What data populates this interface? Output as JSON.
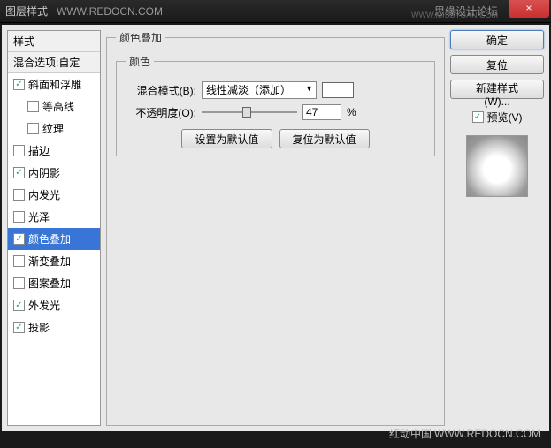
{
  "window": {
    "title": "图层样式",
    "watermark_left": "WWW.REDOCN.COM",
    "watermark_right_top": "思缘设计论坛",
    "watermark_right_sub": "WWW.MISSYUAN.COM",
    "close": "×"
  },
  "styles": {
    "header": "样式",
    "blend_options": "混合选项:自定",
    "items": [
      {
        "label": "斜面和浮雕",
        "checked": true,
        "indent": false
      },
      {
        "label": "等高线",
        "checked": false,
        "indent": true
      },
      {
        "label": "纹理",
        "checked": false,
        "indent": true
      },
      {
        "label": "描边",
        "checked": false,
        "indent": false
      },
      {
        "label": "内阴影",
        "checked": true,
        "indent": false
      },
      {
        "label": "内发光",
        "checked": false,
        "indent": false
      },
      {
        "label": "光泽",
        "checked": false,
        "indent": false
      },
      {
        "label": "颜色叠加",
        "checked": true,
        "indent": false,
        "selected": true
      },
      {
        "label": "渐变叠加",
        "checked": false,
        "indent": false
      },
      {
        "label": "图案叠加",
        "checked": false,
        "indent": false
      },
      {
        "label": "外发光",
        "checked": true,
        "indent": false
      },
      {
        "label": "投影",
        "checked": true,
        "indent": false
      }
    ]
  },
  "panel": {
    "outer_legend": "颜色叠加",
    "inner_legend": "颜色",
    "blend_mode_label": "混合模式(B):",
    "blend_mode_value": "线性减淡（添加）",
    "swatch_color": "#ffffff",
    "opacity_label": "不透明度(O):",
    "opacity_value": "47",
    "opacity_suffix": "%",
    "btn_default": "设置为默认值",
    "btn_reset": "复位为默认值"
  },
  "right": {
    "ok": "确定",
    "cancel": "复位",
    "new_style": "新建样式(W)...",
    "preview_label": "预览(V)",
    "preview_checked": true
  },
  "footer": {
    "brand": "红动中国",
    "url": "WWW.REDOCN.COM"
  }
}
